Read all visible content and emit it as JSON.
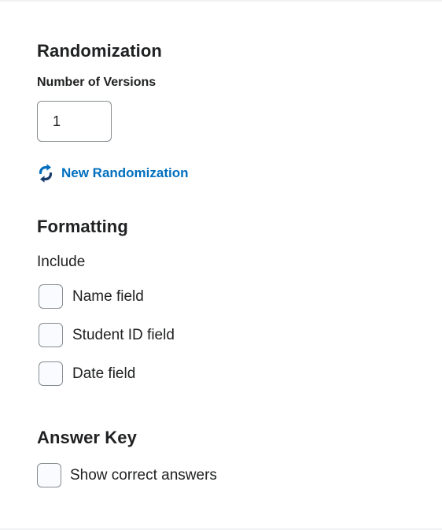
{
  "randomization": {
    "title": "Randomization",
    "versions_label": "Number of Versions",
    "versions_value": "1",
    "new_button_label": "New Randomization",
    "new_button_icon": "shuffle-arrows-icon",
    "accent_color": "#006fbf"
  },
  "formatting": {
    "title": "Formatting",
    "include_label": "Include",
    "options": [
      {
        "label": "Name field",
        "checked": false
      },
      {
        "label": "Student ID field",
        "checked": false
      },
      {
        "label": "Date field",
        "checked": false
      }
    ]
  },
  "answer_key": {
    "title": "Answer Key",
    "options": [
      {
        "label": "Show correct answers",
        "checked": false
      }
    ]
  }
}
